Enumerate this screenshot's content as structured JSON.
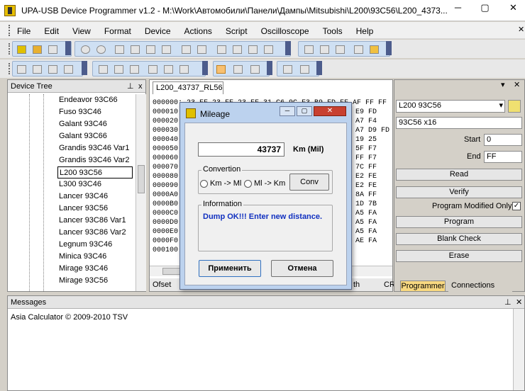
{
  "window": {
    "title": "UPA-USB Device Programmer v1.2 - M:\\Work\\Автомобили\\Панели\\Дампы\\Mitsubishi\\L200\\93C56\\L200_4373...",
    "minimize_glyph": "─",
    "maximize_glyph": "▢",
    "close_glyph": "✕"
  },
  "menu": [
    "File",
    "Edit",
    "View",
    "Format",
    "Device",
    "Actions",
    "Script",
    "Oscilloscope",
    "Tools",
    "Help"
  ],
  "device_tree": {
    "title": "Device Tree",
    "pin_glyph": "⊥",
    "close_glyph": "x",
    "items": [
      "Endeavor 93C66",
      "Fuso 93C46",
      "Galant 93C46",
      "Galant 93C66",
      "Grandis 93C46 Var1",
      "Grandis 93C46 Var2",
      "L200 93C56",
      "L300 93C46",
      "Lancer 93C46",
      "Lancer 93C56",
      "Lancer 93C86 Var1",
      "Lancer 93C86 Var2",
      "Legnum 93C46",
      "Minica 93C46",
      "Mirage 93C46",
      "Mirage 93C56"
    ],
    "selected_index": 6
  },
  "hex": {
    "tab": "L200_43737_RL56",
    "first_line": "000000: 23 FF 23 FF 23 FF 31 C6 9C F3 B9 FD FF AF FF FF",
    "addresses": [
      "000010",
      "000020",
      "000030",
      "000040",
      "000050",
      "000060",
      "000070",
      "000080",
      "000090",
      "0000A0",
      "0000B0",
      "0000C0",
      "0000D0",
      "0000E0",
      "0000F0",
      "000100"
    ],
    "right_cols": [
      "E9 FD",
      "A7 F4",
      "A7 D9 FD",
      "19 25",
      "5F F7",
      "FF F7",
      "7C FF",
      "E2 FE",
      "E2 FE",
      "8A FF",
      "1D 7B",
      "A5 FA",
      "A5 FA",
      "A5 FA",
      "AE FA",
      ""
    ],
    "status_offset": "Ofset",
    "status_len": "th",
    "status_crc": "CRC"
  },
  "programmer": {
    "device": "L200 93C56",
    "device_info": "93C56 x16",
    "start_label": "Start",
    "start_value": "0",
    "end_label": "End",
    "end_value": "FF",
    "buttons": {
      "read": "Read",
      "verify": "Verify",
      "program": "Program",
      "blank_check": "Blank Check",
      "erase": "Erase"
    },
    "program_modified_only": "Program Modified Only",
    "program_modified_checked": true,
    "tabs": [
      "Programmer",
      "Connections"
    ]
  },
  "messages": {
    "title": "Messages",
    "lines": [
      "Asia Calculator  © 2009-2010 TSV"
    ]
  },
  "dialog": {
    "title": "Mileage",
    "value": "43737",
    "unit": "Km (Mil)",
    "conversion_group": "Convertion",
    "radio_km_mi": "Km -> Ml",
    "radio_mi_km": "Ml -> Km",
    "conv_button": "Conv",
    "info_group": "Information",
    "info_text": "Dump OK!!! Enter new distance.",
    "apply_button": "Применить",
    "cancel_button": "Отмена"
  }
}
